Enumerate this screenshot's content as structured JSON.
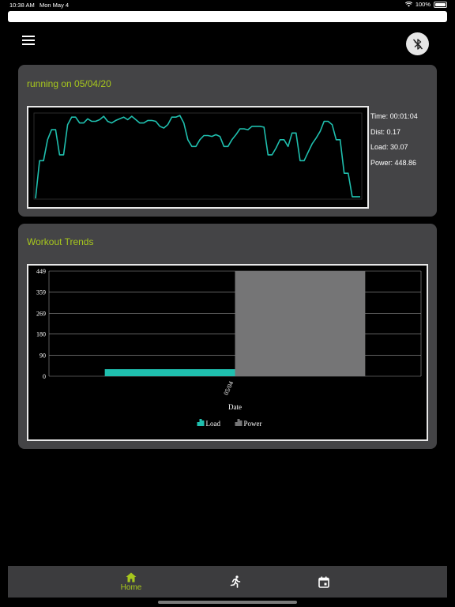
{
  "status_bar": {
    "time": "10:38 AM",
    "date": "Mon May 4",
    "battery": "100%"
  },
  "header": {
    "menu_icon": "hamburger-menu-icon",
    "bluetooth_icon": "bluetooth-disabled-icon"
  },
  "workout_card": {
    "title": "running on 05/04/20",
    "stats": {
      "time": "Time: 00:01:04",
      "dist": "Dist: 0.17",
      "load": "Load: 30.07",
      "power": "Power: 448.86"
    },
    "line_color": "#1fbfae",
    "line_values": [
      0.0,
      0.45,
      0.45,
      0.7,
      0.82,
      0.82,
      0.52,
      0.52,
      0.88,
      0.97,
      0.97,
      0.9,
      0.9,
      0.95,
      0.92,
      0.92,
      0.94,
      0.98,
      0.92,
      0.9,
      0.93,
      0.95,
      0.97,
      0.94,
      0.98,
      0.94,
      0.9,
      0.9,
      0.93,
      0.93,
      0.92,
      0.86,
      0.84,
      0.88,
      0.97,
      0.97,
      0.99,
      0.9,
      0.7,
      0.62,
      0.62,
      0.7,
      0.75,
      0.75,
      0.74,
      0.76,
      0.74,
      0.62,
      0.62,
      0.7,
      0.76,
      0.83,
      0.83,
      0.82,
      0.86,
      0.86,
      0.86,
      0.85,
      0.52,
      0.52,
      0.6,
      0.7,
      0.7,
      0.62,
      0.78,
      0.78,
      0.45,
      0.45,
      0.55,
      0.65,
      0.72,
      0.8,
      0.92,
      0.92,
      0.88,
      0.7,
      0.7,
      0.3,
      0.3,
      0.02,
      0.02,
      0.02
    ]
  },
  "trends_card": {
    "title": "Workout Trends",
    "chart_data": {
      "type": "bar",
      "categories": [
        "05/04"
      ],
      "series": [
        {
          "name": "Load",
          "values": [
            30.07
          ],
          "color": "#1fbfae"
        },
        {
          "name": "Power",
          "values": [
            448.86
          ],
          "color": "#757576"
        }
      ],
      "xlabel": "Date",
      "ylabel": "",
      "ylim": [
        0,
        449
      ],
      "yticks": [
        "0",
        "90",
        "180",
        "269",
        "359",
        "449"
      ],
      "grid": true,
      "legend": "bottom"
    }
  },
  "bottom_nav": {
    "home_label": "Home",
    "active_color": "#a7c71d"
  }
}
